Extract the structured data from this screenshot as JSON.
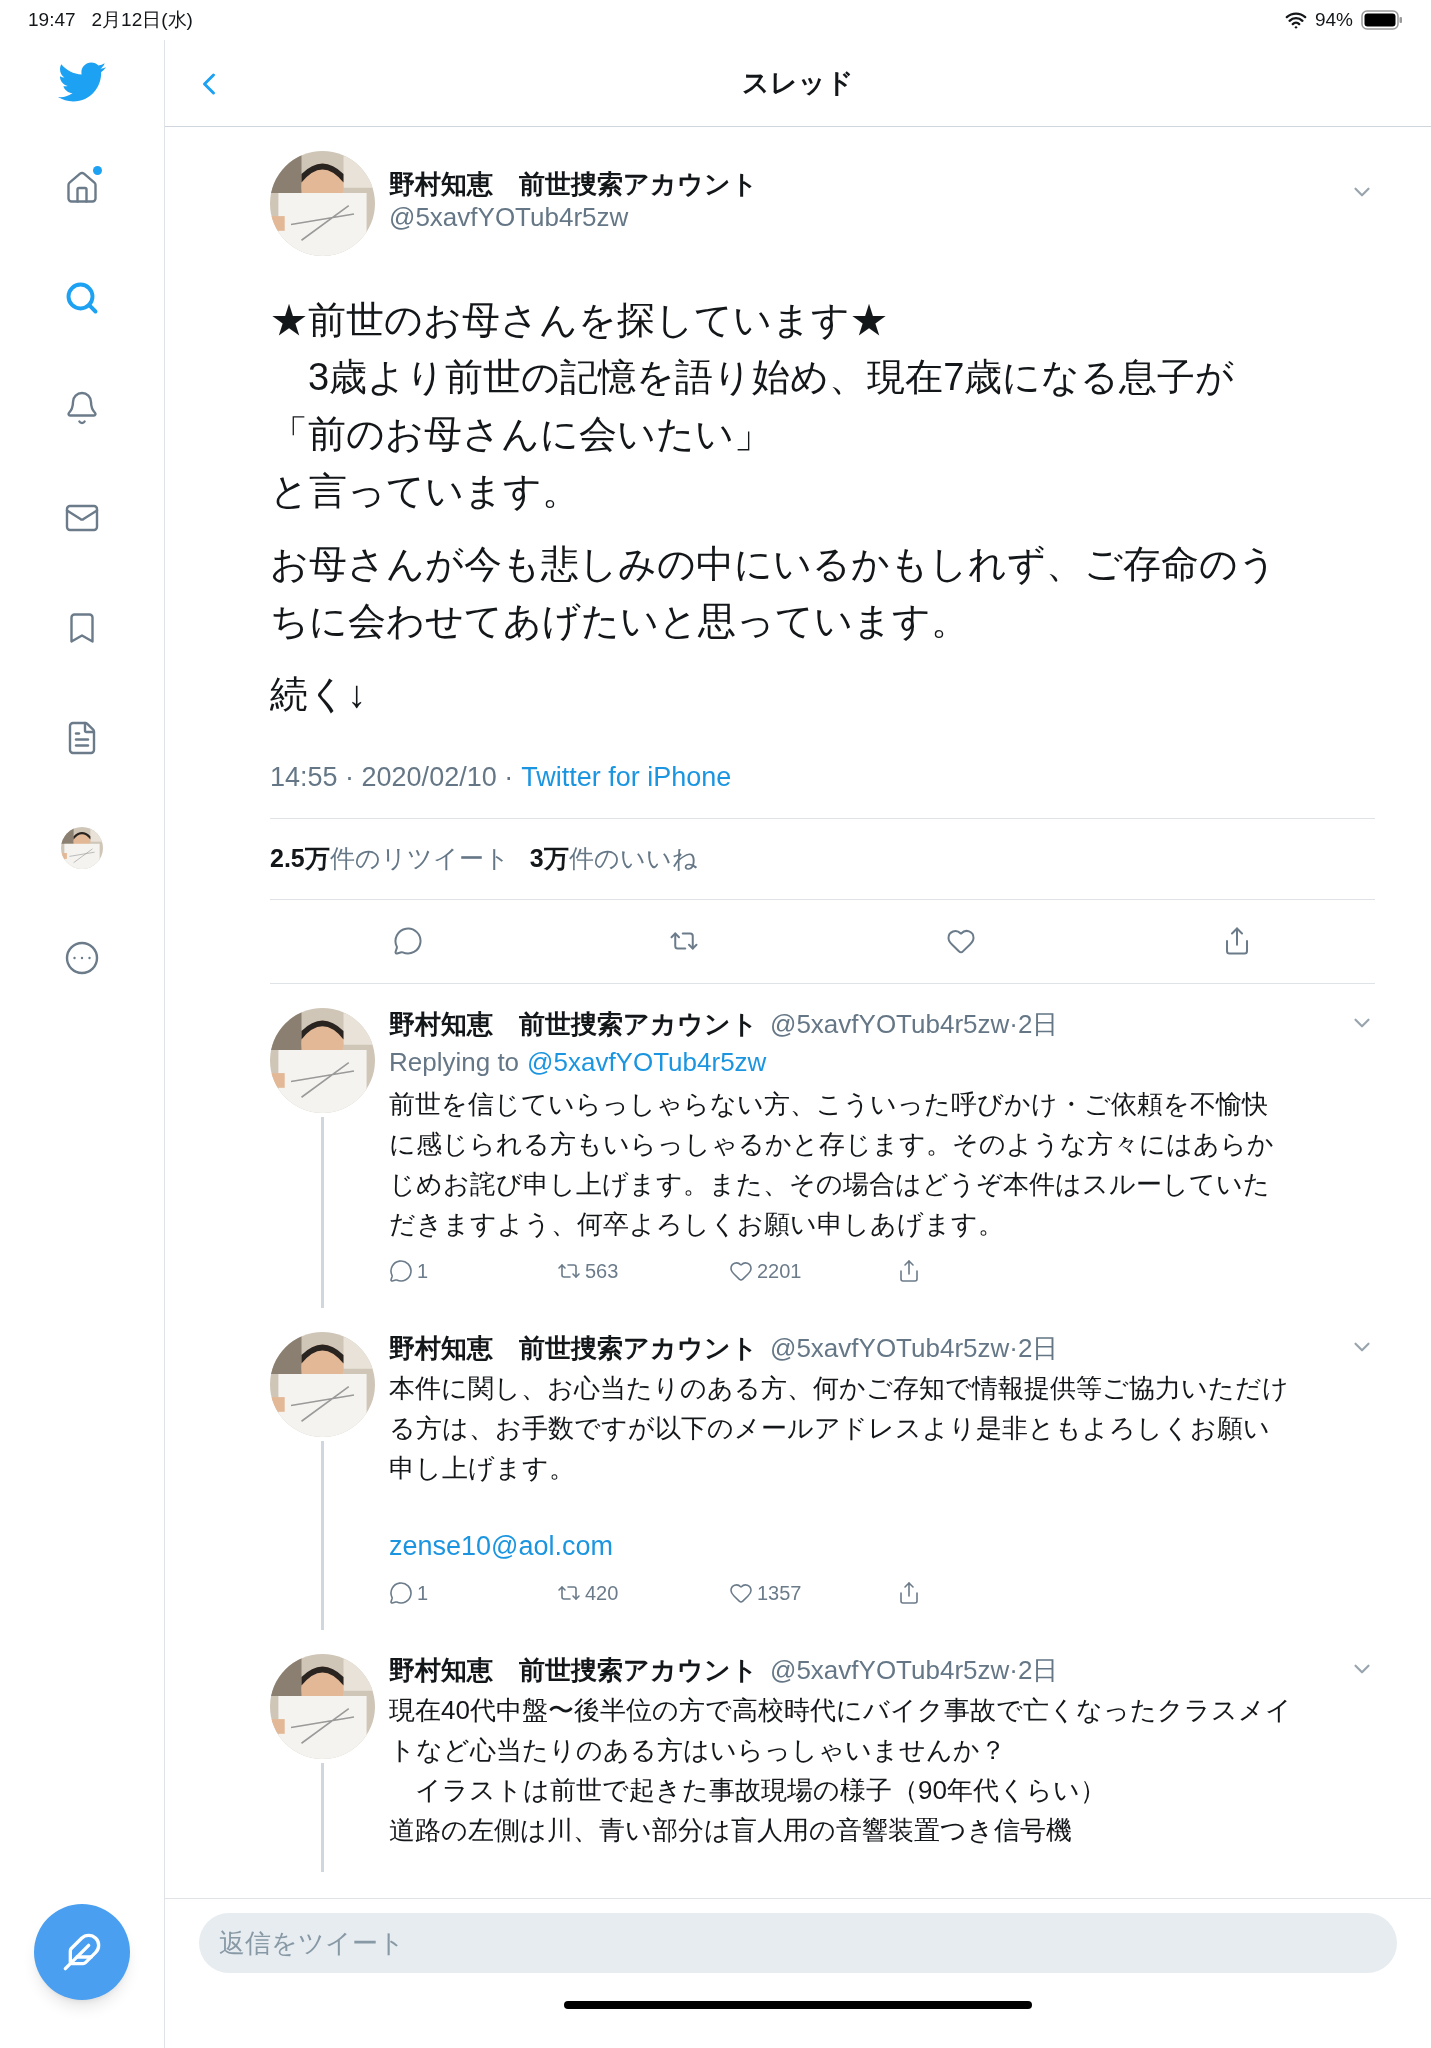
{
  "status_bar": {
    "time": "19:47",
    "date": "2月12日(水)",
    "battery": "94%"
  },
  "sidebar": {
    "items": [
      {
        "kind": "home",
        "selected": false,
        "badge": true
      },
      {
        "kind": "search",
        "selected": true,
        "badge": false
      },
      {
        "kind": "notifications",
        "selected": false,
        "badge": false
      },
      {
        "kind": "messages",
        "selected": false,
        "badge": false
      },
      {
        "kind": "bookmarks",
        "selected": false,
        "badge": false
      },
      {
        "kind": "lists",
        "selected": false,
        "badge": false
      },
      {
        "kind": "profile",
        "selected": false,
        "badge": false
      },
      {
        "kind": "more",
        "selected": false,
        "badge": false
      }
    ]
  },
  "header": {
    "title": "スレッド"
  },
  "main_tweet": {
    "name": "野村知恵　前世捜索アカウント",
    "handle": "@5xavfYOTub4r5zw",
    "paragraphs": [
      [
        "★前世のお母さんを探しています★",
        "　3歳より前世の記憶を語り始め、現在7歳になる息子が",
        "「前のお母さんに会いたい」",
        "と言っています。"
      ],
      [
        "お母さんが今も悲しみの中にいるかもしれず、ご存命のうちに会わせてあげたいと思っています。"
      ],
      [
        "続く↓"
      ]
    ],
    "meta": "14:55 · 2020/02/10 ·",
    "source": "Twitter for iPhone",
    "stats": [
      {
        "count": "2.5万",
        "label": "件のリツイート"
      },
      {
        "count": "3万",
        "label": "件のいいね"
      }
    ]
  },
  "replies": [
    {
      "name": "野村知恵　前世捜索アカウント",
      "handle_time": "@5xavfYOTub4r5zw·2日",
      "replying_label": "Replying to",
      "replying_handle": "@5xavfYOTub4r5zw",
      "lines": [
        "前世を信じていらっしゃらない方、こういった呼びかけ・ご依頼を不愉快に感じられる方もいらっしゃるかと存じます。そのような方々にはあらかじめお詫び申し上げます。また、その場合はどうぞ本件はスルーしていただきますよう、何卒よろしくお願い申しあげます。"
      ],
      "replies": "1",
      "retweets": "563",
      "likes": "2201"
    },
    {
      "name": "野村知恵　前世捜索アカウント",
      "handle_time": "@5xavfYOTub4r5zw·2日",
      "lines": [
        "本件に関し、お心当たりのある方、何かご存知で情報提供等ご協力いただける方は、お手数ですが以下のメールアドレスより是非ともよろしくお願い申し上げます。"
      ],
      "link": "zense10@aol.com",
      "replies": "1",
      "retweets": "420",
      "likes": "1357"
    },
    {
      "name": "野村知恵　前世捜索アカウント",
      "handle_time": "@5xavfYOTub4r5zw·2日",
      "lines": [
        "現在40代中盤〜後半位の方で高校時代にバイク事故で亡くなったクラスメイトなど心当たりのある方はいらっしゃいませんか？",
        "　イラストは前世で起きた事故現場の様子（90年代くらい）",
        "道路の左側は川、青い部分は盲人用の音響装置つき信号機"
      ]
    }
  ],
  "reply_bar": {
    "placeholder": "返信をツイート"
  }
}
